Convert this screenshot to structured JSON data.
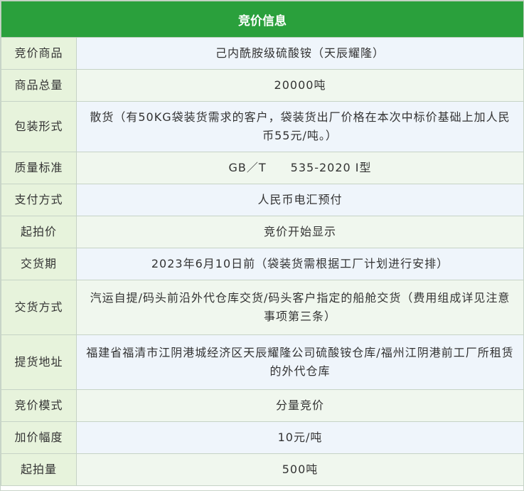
{
  "header": {
    "title": "竞价信息"
  },
  "rows": [
    {
      "label": "竞价商品",
      "value": "己内酰胺级硫酸铵（天辰耀隆）"
    },
    {
      "label": "商品总量",
      "value": "20000吨"
    },
    {
      "label": "包装形式",
      "value": "散货（有50KG袋装货需求的客户，袋装货出厂价格在本次中标价基础上加人民币55元/吨。）"
    },
    {
      "label": "质量标准",
      "value": "GB／T　　535-2020 I型"
    },
    {
      "label": "支付方式",
      "value": "人民币电汇预付"
    },
    {
      "label": "起拍价",
      "value": "竞价开始显示"
    },
    {
      "label": "交货期",
      "value": "2023年6月10日前（袋装货需根据工厂计划进行安排）"
    },
    {
      "label": "交货方式",
      "value": "汽运自提/码头前沿外代仓库交货/码头客户指定的船舱交货（费用组成详见注意事项第三条）"
    },
    {
      "label": "提货地址",
      "value": "福建省福清市江阴港城经济区天辰耀隆公司硫酸铵仓库/福州江阴港前工厂所租赁的外代仓库"
    },
    {
      "label": "竞价模式",
      "value": "分量竞价"
    },
    {
      "label": "加价幅度",
      "value": "10元/吨"
    },
    {
      "label": "起拍量",
      "value": "500吨"
    }
  ]
}
